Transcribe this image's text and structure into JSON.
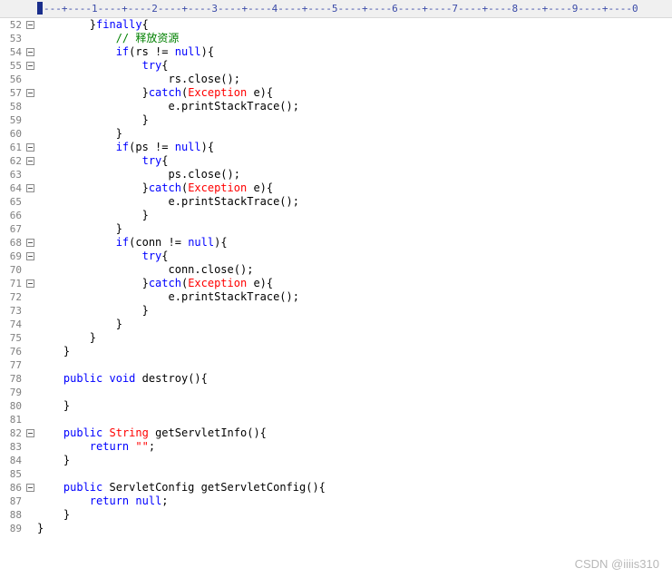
{
  "ruler": {
    "scale": "---+----1----+----2----+----3----+----4----+----5----+----6----+----7----+----8----+----9----+----0"
  },
  "lines": [
    {
      "num": "52",
      "fold": true,
      "tokens": [
        {
          "t": "        }"
        },
        {
          "t": "finally",
          "c": "kw"
        },
        {
          "t": "{"
        }
      ]
    },
    {
      "num": "53",
      "fold": false,
      "tokens": [
        {
          "t": "            "
        },
        {
          "t": "// 释放资源",
          "c": "cm"
        }
      ]
    },
    {
      "num": "54",
      "fold": true,
      "tokens": [
        {
          "t": "            "
        },
        {
          "t": "if",
          "c": "kw"
        },
        {
          "t": "(rs != "
        },
        {
          "t": "null",
          "c": "kw"
        },
        {
          "t": "){"
        }
      ]
    },
    {
      "num": "55",
      "fold": true,
      "tokens": [
        {
          "t": "                "
        },
        {
          "t": "try",
          "c": "kw"
        },
        {
          "t": "{"
        }
      ]
    },
    {
      "num": "56",
      "fold": false,
      "tokens": [
        {
          "t": "                    rs.close();"
        }
      ]
    },
    {
      "num": "57",
      "fold": true,
      "tokens": [
        {
          "t": "                }"
        },
        {
          "t": "catch",
          "c": "kw"
        },
        {
          "t": "("
        },
        {
          "t": "Exception",
          "c": "ty"
        },
        {
          "t": " e){"
        }
      ]
    },
    {
      "num": "58",
      "fold": false,
      "tokens": [
        {
          "t": "                    e.printStackTrace();"
        }
      ]
    },
    {
      "num": "59",
      "fold": false,
      "tokens": [
        {
          "t": "                }"
        }
      ]
    },
    {
      "num": "60",
      "fold": false,
      "tokens": [
        {
          "t": "            }"
        }
      ]
    },
    {
      "num": "61",
      "fold": true,
      "tokens": [
        {
          "t": "            "
        },
        {
          "t": "if",
          "c": "kw"
        },
        {
          "t": "(ps != "
        },
        {
          "t": "null",
          "c": "kw"
        },
        {
          "t": "){"
        }
      ]
    },
    {
      "num": "62",
      "fold": true,
      "tokens": [
        {
          "t": "                "
        },
        {
          "t": "try",
          "c": "kw"
        },
        {
          "t": "{"
        }
      ]
    },
    {
      "num": "63",
      "fold": false,
      "tokens": [
        {
          "t": "                    ps.close();"
        }
      ]
    },
    {
      "num": "64",
      "fold": true,
      "tokens": [
        {
          "t": "                }"
        },
        {
          "t": "catch",
          "c": "kw"
        },
        {
          "t": "("
        },
        {
          "t": "Exception",
          "c": "ty"
        },
        {
          "t": " e){"
        }
      ]
    },
    {
      "num": "65",
      "fold": false,
      "tokens": [
        {
          "t": "                    e.printStackTrace();"
        }
      ]
    },
    {
      "num": "66",
      "fold": false,
      "tokens": [
        {
          "t": "                }"
        }
      ]
    },
    {
      "num": "67",
      "fold": false,
      "tokens": [
        {
          "t": "            }"
        }
      ]
    },
    {
      "num": "68",
      "fold": true,
      "tokens": [
        {
          "t": "            "
        },
        {
          "t": "if",
          "c": "kw"
        },
        {
          "t": "(conn != "
        },
        {
          "t": "null",
          "c": "kw"
        },
        {
          "t": "){"
        }
      ]
    },
    {
      "num": "69",
      "fold": true,
      "tokens": [
        {
          "t": "                "
        },
        {
          "t": "try",
          "c": "kw"
        },
        {
          "t": "{"
        }
      ]
    },
    {
      "num": "70",
      "fold": false,
      "tokens": [
        {
          "t": "                    conn.close();"
        }
      ]
    },
    {
      "num": "71",
      "fold": true,
      "tokens": [
        {
          "t": "                }"
        },
        {
          "t": "catch",
          "c": "kw"
        },
        {
          "t": "("
        },
        {
          "t": "Exception",
          "c": "ty"
        },
        {
          "t": " e){"
        }
      ]
    },
    {
      "num": "72",
      "fold": false,
      "tokens": [
        {
          "t": "                    e.printStackTrace();"
        }
      ]
    },
    {
      "num": "73",
      "fold": false,
      "tokens": [
        {
          "t": "                }"
        }
      ]
    },
    {
      "num": "74",
      "fold": false,
      "tokens": [
        {
          "t": "            }"
        }
      ]
    },
    {
      "num": "75",
      "fold": false,
      "tokens": [
        {
          "t": "        }"
        }
      ]
    },
    {
      "num": "76",
      "fold": false,
      "tokens": [
        {
          "t": "    }"
        }
      ]
    },
    {
      "num": "77",
      "fold": false,
      "tokens": []
    },
    {
      "num": "78",
      "fold": false,
      "tokens": [
        {
          "t": "    "
        },
        {
          "t": "public",
          "c": "kw"
        },
        {
          "t": " "
        },
        {
          "t": "void",
          "c": "kw"
        },
        {
          "t": " destroy(){"
        }
      ]
    },
    {
      "num": "79",
      "fold": false,
      "tokens": []
    },
    {
      "num": "80",
      "fold": false,
      "tokens": [
        {
          "t": "    }"
        }
      ]
    },
    {
      "num": "81",
      "fold": false,
      "tokens": []
    },
    {
      "num": "82",
      "fold": true,
      "tokens": [
        {
          "t": "    "
        },
        {
          "t": "public",
          "c": "kw"
        },
        {
          "t": " "
        },
        {
          "t": "String",
          "c": "ty"
        },
        {
          "t": " getServletInfo(){"
        }
      ]
    },
    {
      "num": "83",
      "fold": false,
      "tokens": [
        {
          "t": "        "
        },
        {
          "t": "return",
          "c": "kw"
        },
        {
          "t": " "
        },
        {
          "t": "\"\"",
          "c": "st"
        },
        {
          "t": ";"
        }
      ]
    },
    {
      "num": "84",
      "fold": false,
      "tokens": [
        {
          "t": "    }"
        }
      ]
    },
    {
      "num": "85",
      "fold": false,
      "tokens": []
    },
    {
      "num": "86",
      "fold": true,
      "tokens": [
        {
          "t": "    "
        },
        {
          "t": "public",
          "c": "kw"
        },
        {
          "t": " ServletConfig getServletConfig(){"
        }
      ]
    },
    {
      "num": "87",
      "fold": false,
      "tokens": [
        {
          "t": "        "
        },
        {
          "t": "return",
          "c": "kw"
        },
        {
          "t": " "
        },
        {
          "t": "null",
          "c": "kw"
        },
        {
          "t": ";"
        }
      ]
    },
    {
      "num": "88",
      "fold": false,
      "tokens": [
        {
          "t": "    }"
        }
      ]
    },
    {
      "num": "89",
      "fold": false,
      "tokens": [
        {
          "t": "}"
        }
      ]
    }
  ],
  "watermark": "CSDN @iiiis310"
}
